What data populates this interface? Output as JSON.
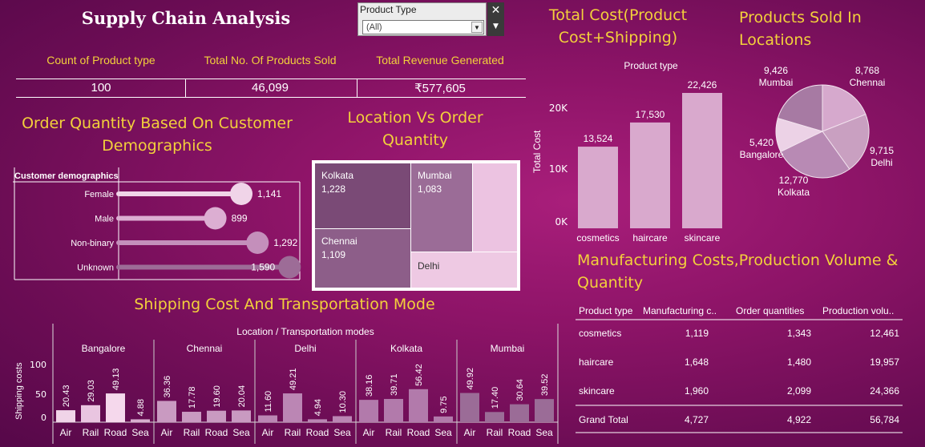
{
  "dashboard": {
    "title": "Supply Chain Analysis",
    "filter": {
      "label": "Product Type",
      "value": "(All)"
    },
    "kpis": [
      {
        "label": "Count of Product type",
        "value": "100"
      },
      {
        "label": "Total No. Of Products Sold",
        "value": "46,099"
      },
      {
        "label": "Total Revenue Generated",
        "value": "₹577,605"
      }
    ]
  },
  "demographics": {
    "title_line1": "Order Quantity Based On Customer",
    "title_line2": "Demographics",
    "header": "Customer demographics",
    "rows": [
      {
        "label": "Female",
        "value": 1141,
        "text": "1,141"
      },
      {
        "label": "Male",
        "value": 899,
        "text": "899"
      },
      {
        "label": "Non-binary",
        "value": 1292,
        "text": "1,292"
      },
      {
        "label": "Unknown",
        "value": 1590,
        "text": "1,590"
      }
    ],
    "colors": [
      "#f0d4e8",
      "#dcaed2",
      "#c48fbb",
      "#9d6c97"
    ]
  },
  "location": {
    "title_line1": "Location Vs Order",
    "title_line2": "Quantity",
    "cells": [
      {
        "name": "Kolkata",
        "value": "1,228",
        "color": "#7a4a76"
      },
      {
        "name": "Mumbai",
        "value": "1,083",
        "color": "#9b6c97"
      },
      {
        "name": "Chennai",
        "value": "1,109",
        "color": "#8d5e89"
      },
      {
        "name": "Delhi",
        "value": "",
        "color": "#eec9e3"
      },
      {
        "name": "",
        "value": "",
        "color": "#ecc3e1"
      }
    ]
  },
  "shipping": {
    "title": "Shipping Cost And  Transportation Mode",
    "axis_title": "Location / Transportation modes",
    "ylabel": "Shipping costs",
    "yticks": [
      "100",
      "50",
      "0"
    ],
    "modes": [
      "Air",
      "Rail",
      "Road",
      "Sea"
    ],
    "groups": [
      {
        "location": "Bangalore",
        "values": [
          20.43,
          29.03,
          49.13,
          4.88
        ],
        "labels": [
          "20.43",
          "29.03",
          "49.13",
          "4.88"
        ],
        "colors": [
          "#f0d4e8",
          "#e9c5e0",
          "#f5d8ec",
          "#d8aecf"
        ]
      },
      {
        "location": "Chennai",
        "values": [
          36.36,
          17.78,
          19.6,
          20.04
        ],
        "labels": [
          "36.36",
          "17.78",
          "19.60",
          "20.04"
        ],
        "colors": [
          "#c99ac1",
          "#c99ac1",
          "#c99ac1",
          "#c99ac1"
        ]
      },
      {
        "location": "Delhi",
        "values": [
          11.6,
          49.21,
          4.94,
          10.3
        ],
        "labels": [
          "11.60",
          "49.21",
          "4.94",
          "10.30"
        ],
        "colors": [
          "#bb86b4",
          "#bb86b4",
          "#bb86b4",
          "#bb86b4"
        ]
      },
      {
        "location": "Kolkata",
        "values": [
          38.16,
          39.71,
          56.42,
          9.75
        ],
        "labels": [
          "38.16",
          "39.71",
          "56.42",
          "9.75"
        ],
        "colors": [
          "#b27aab",
          "#b27aab",
          "#b27aab",
          "#b27aab"
        ]
      },
      {
        "location": "Mumbai",
        "values": [
          49.92,
          17.4,
          30.64,
          39.52
        ],
        "labels": [
          "49.92",
          "17.40",
          "30.64",
          "39.52"
        ],
        "colors": [
          "#9b6c97",
          "#9b6c97",
          "#9b6c97",
          "#9b6c97"
        ]
      }
    ]
  },
  "total_cost": {
    "title_line1": "Total Cost(Product",
    "title_line2": "Cost+Shipping)",
    "axis_title": "Product type",
    "ylabel": "Total Cost",
    "yticks": [
      "20K",
      "10K",
      "0K"
    ],
    "bars": [
      {
        "label": "cosmetics",
        "value": 13524,
        "text": "13,524"
      },
      {
        "label": "haircare",
        "value": 17530,
        "text": "17,530"
      },
      {
        "label": "skincare",
        "value": 22426,
        "text": "22,426"
      }
    ],
    "color": "#d9a9cd"
  },
  "products_sold": {
    "title_line1": "Products Sold In",
    "title_line2": "Locations",
    "slices": [
      {
        "name": "Mumbai",
        "value": 9426,
        "text": "9,426",
        "color": "#a77aa3"
      },
      {
        "name": "Chennai",
        "value": 8768,
        "text": "8,768",
        "color": "#d6a9cd"
      },
      {
        "name": "Delhi",
        "value": 9715,
        "text": "9,715",
        "color": "#c9a0c1"
      },
      {
        "name": "Kolkata",
        "value": 12770,
        "text": "12,770",
        "color": "#b88ab4"
      },
      {
        "name": "Bangalore",
        "value": 5420,
        "text": "5,420",
        "color": "#ecd2e6"
      }
    ]
  },
  "manufacturing": {
    "title_line1": "Manufacturing Costs,Production Volume &",
    "title_line2": "Quantity",
    "headers": [
      "Product type",
      "Manufacturing c..",
      "Order quantities",
      "Production volu.."
    ],
    "rows": [
      [
        "cosmetics",
        "1,119",
        "1,343",
        "12,461"
      ],
      [
        "haircare",
        "1,648",
        "1,480",
        "19,957"
      ],
      [
        "skincare",
        "1,960",
        "2,099",
        "24,366"
      ]
    ],
    "total": [
      "Grand Total",
      "4,727",
      "4,922",
      "56,784"
    ]
  },
  "chart_data": [
    {
      "type": "bar",
      "xlabel": "Product type",
      "ylabel": "Total Cost",
      "categories": [
        "cosmetics",
        "haircare",
        "skincare"
      ],
      "values": [
        13524,
        17530,
        22426
      ],
      "ylim": [
        0,
        25000
      ]
    },
    {
      "type": "pie",
      "title": "Products Sold In Locations",
      "categories": [
        "Mumbai",
        "Chennai",
        "Delhi",
        "Kolkata",
        "Bangalore"
      ],
      "values": [
        9426,
        8768,
        9715,
        12770,
        5420
      ]
    },
    {
      "type": "bar",
      "title": "Shipping Cost And  Transportation Mode",
      "xlabel": "Location / Transportation modes",
      "ylabel": "Shipping costs",
      "categories": [
        "Air",
        "Rail",
        "Road",
        "Sea"
      ],
      "series": [
        {
          "name": "Bangalore",
          "values": [
            20.43,
            29.03,
            49.13,
            4.88
          ]
        },
        {
          "name": "Chennai",
          "values": [
            36.36,
            17.78,
            19.6,
            20.04
          ]
        },
        {
          "name": "Delhi",
          "values": [
            11.6,
            49.21,
            4.94,
            10.3
          ]
        },
        {
          "name": "Kolkata",
          "values": [
            38.16,
            39.71,
            56.42,
            9.75
          ]
        },
        {
          "name": "Mumbai",
          "values": [
            49.92,
            17.4,
            30.64,
            39.52
          ]
        }
      ],
      "ylim": [
        0,
        110
      ]
    },
    {
      "type": "bar",
      "title": "Order Quantity Based On Customer Demographics",
      "categories": [
        "Female",
        "Male",
        "Non-binary",
        "Unknown"
      ],
      "values": [
        1141,
        899,
        1292,
        1590
      ]
    }
  ]
}
